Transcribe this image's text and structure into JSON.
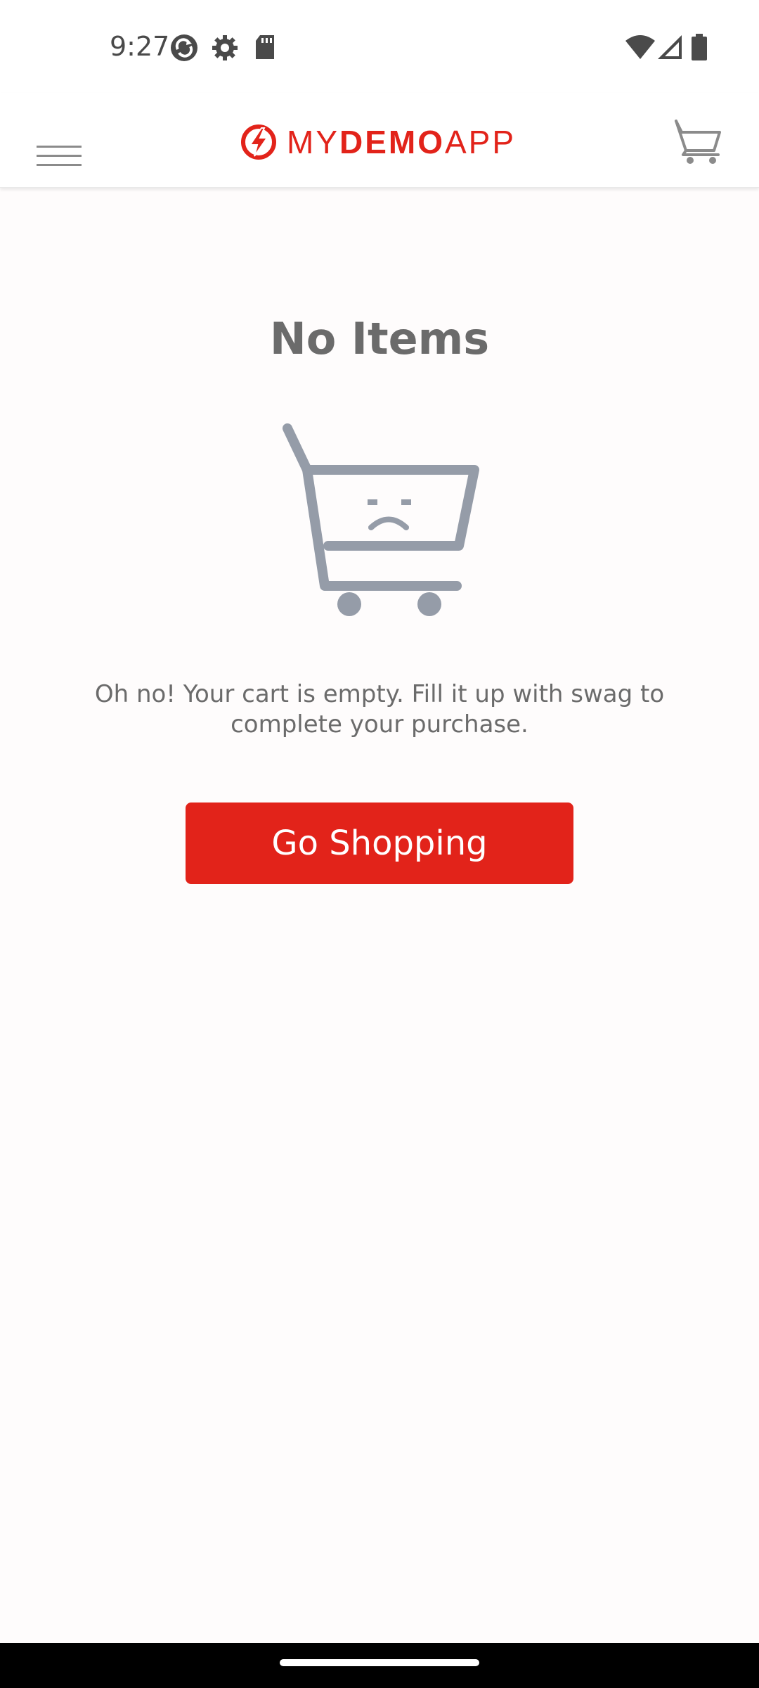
{
  "status_bar": {
    "time": "9:27",
    "icons": [
      "sync-icon",
      "settings-gear-icon",
      "sd-card-icon",
      "wifi-icon",
      "cellular-signal-icon",
      "battery-icon"
    ]
  },
  "header": {
    "menu_icon": "hamburger-menu-icon",
    "logo_prefix": "MY",
    "logo_bold": "DEMO",
    "logo_suffix": "APP",
    "cart_icon": "cart-icon"
  },
  "content": {
    "title": "No Items",
    "illustration": "sad-cart-icon",
    "message": "Oh no! Your cart is empty. Fill it up with swag to complete your purchase.",
    "button_label": "Go Shopping"
  },
  "colors": {
    "brand_red": "#e2231a",
    "text_gray": "#6b6b6b",
    "illustration_gray": "#959ca8"
  }
}
